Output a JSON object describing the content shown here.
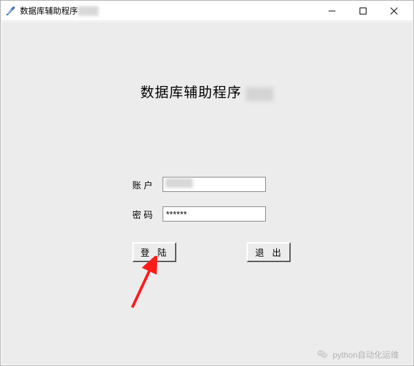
{
  "window": {
    "title": "数据库辅助程序"
  },
  "heading": {
    "text": "数据库辅助程序"
  },
  "form": {
    "account_label": "账 户",
    "account_value": "",
    "password_label": "密 码",
    "password_value": "******"
  },
  "buttons": {
    "login_label": "登 陆",
    "exit_label": "退 出"
  },
  "watermark": {
    "text": "python自动化运维"
  },
  "icons": {
    "feather": "feather-icon",
    "minimize": "minimize-icon",
    "maximize": "maximize-icon",
    "close": "close-icon",
    "wechat": "wechat-icon",
    "arrow": "pointer-arrow"
  }
}
